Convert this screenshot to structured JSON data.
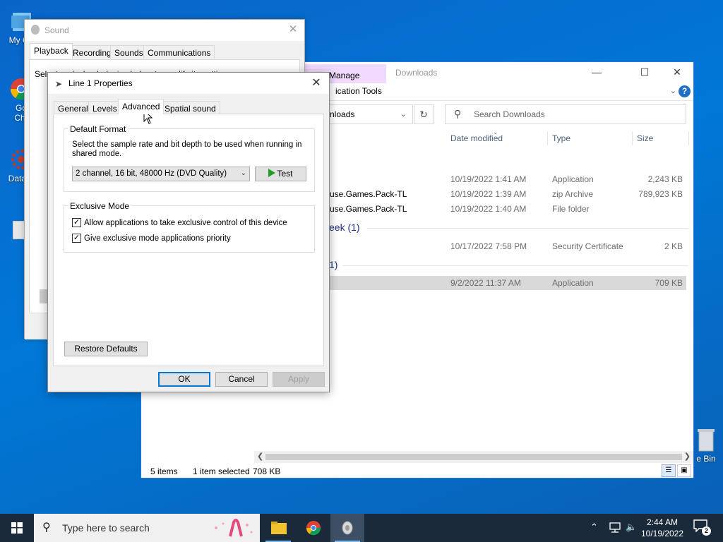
{
  "desktop": {
    "icons": [
      {
        "label": "My Co"
      },
      {
        "label": "Go\nChr"
      },
      {
        "label": "DataW"
      },
      {
        "label": "e Bin"
      }
    ]
  },
  "explorer": {
    "manage_tab": "Manage",
    "title": "Downloads",
    "ribbon_tab": "ication Tools",
    "address": "nloads",
    "search_placeholder": "Search Downloads",
    "columns": {
      "date": "Date modified",
      "type": "Type",
      "size": "Size"
    },
    "rows": [
      {
        "name": "",
        "date": "10/19/2022 1:41 AM",
        "type": "Application",
        "size": "2,243 KB"
      },
      {
        "name": "use.Games.Pack-TL",
        "date": "10/19/2022 1:39 AM",
        "type": "zip Archive",
        "size": "789,923 KB"
      },
      {
        "name": "use.Games.Pack-TL",
        "date": "10/19/2022 1:40 AM",
        "type": "File folder",
        "size": ""
      }
    ],
    "group_week": "eek (1)",
    "row_week": {
      "date": "10/17/2022 7:58 PM",
      "type": "Security Certificate",
      "size": "2 KB"
    },
    "group_earlier": "1)",
    "row_selected": {
      "date": "9/2/2022 11:37 AM",
      "type": "Application",
      "size": "709 KB"
    },
    "status": {
      "items": "5 items",
      "selected": "1 item selected",
      "size": "708 KB"
    }
  },
  "sound": {
    "title": "Sound",
    "tabs": [
      "Playback",
      "Recording",
      "Sounds",
      "Communications"
    ],
    "panel_text": "Select a playback device below to modify its settings:"
  },
  "props": {
    "title": "Line 1 Properties",
    "tabs": [
      "General",
      "Levels",
      "Advanced",
      "Spatial sound"
    ],
    "default_format": {
      "title": "Default Format",
      "description": "Select the sample rate and bit depth to be used when running in shared mode.",
      "selected": "2 channel, 16 bit, 48000 Hz (DVD Quality)",
      "test_label": "Test"
    },
    "exclusive": {
      "title": "Exclusive Mode",
      "allow_label": "Allow applications to take exclusive control of this device",
      "priority_label": "Give exclusive mode applications priority",
      "allow_checked": true,
      "priority_checked": true
    },
    "restore_label": "Restore Defaults",
    "ok_label": "OK",
    "cancel_label": "Cancel",
    "apply_label": "Apply"
  },
  "taskbar": {
    "search_placeholder": "Type here to search",
    "time": "2:44 AM",
    "date": "10/19/2022",
    "notification_count": "2"
  },
  "colors": {
    "desktop": "#0078d7",
    "accent": "#0078d7",
    "taskbar": "#1b2a3a",
    "manage_tab": "#f2d9ff"
  }
}
